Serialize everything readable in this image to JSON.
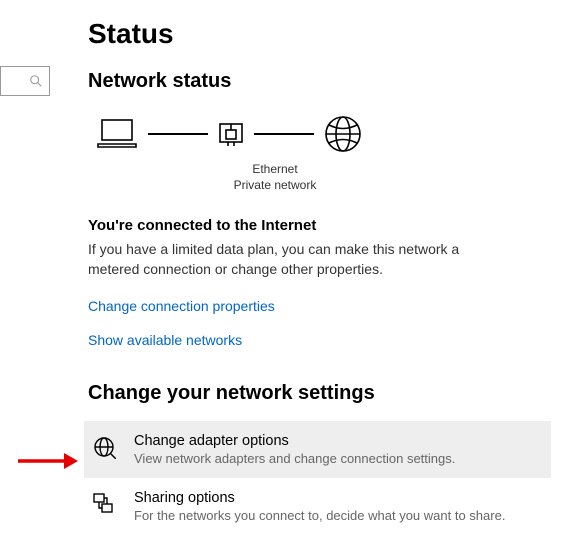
{
  "page": {
    "title": "Status"
  },
  "section": {
    "network_status": "Network status",
    "diagram": {
      "connection_name": "Ethernet",
      "network_profile": "Private network"
    },
    "connected_heading": "You're connected to the Internet",
    "connected_desc": "If you have a limited data plan, you can make this network a metered connection or change other properties.",
    "link_change_props": "Change connection properties",
    "link_show_networks": "Show available networks"
  },
  "change_settings": {
    "title": "Change your network settings",
    "options": [
      {
        "title": "Change adapter options",
        "desc": "View network adapters and change connection settings."
      },
      {
        "title": "Sharing options",
        "desc": "For the networks you connect to, decide what you want to share."
      }
    ]
  },
  "search": {
    "placeholder": ""
  }
}
